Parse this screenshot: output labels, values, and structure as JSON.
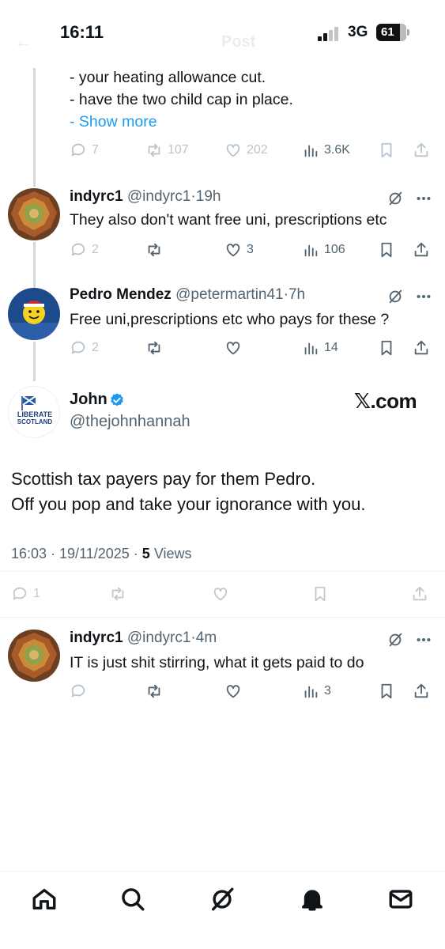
{
  "status_bar": {
    "time": "16:11",
    "network": "3G",
    "battery": "61"
  },
  "header": {
    "back_label": "←",
    "title": "Post"
  },
  "quoted_post": {
    "lines": [
      "- your heating allowance cut.",
      "- have the two child cap in place."
    ],
    "show_more_prefix": "- ",
    "show_more": "Show more",
    "actions": {
      "replies": "7",
      "reposts": "107",
      "likes": "202",
      "views": "3.6K"
    }
  },
  "posts": [
    {
      "name": "indyrc1",
      "handle": "@indyrc1",
      "time": "19h",
      "text": "They also don't want free uni, prescriptions etc",
      "actions": {
        "replies": "2",
        "reposts": "",
        "likes": "3",
        "views": "106"
      }
    },
    {
      "name": "Pedro Mendez",
      "handle": "@petermartin41",
      "time": "7h",
      "text": "Free uni,prescriptions etc who pays for these ?",
      "actions": {
        "replies": "2",
        "reposts": "",
        "likes": "",
        "views": "14"
      }
    }
  ],
  "main_post": {
    "name": "John",
    "handle": "@thejohnhannah",
    "avatar_text": [
      "LIBERATE",
      "SCOTLAND"
    ],
    "watermark": "𝕏.com",
    "text_lines": [
      "Scottish tax payers pay for them Pedro.",
      "Off you pop and take your ignorance with you."
    ],
    "timestamp": "16:03 · 19/11/2025 · ",
    "views_count": "5",
    "views_label": " Views",
    "actions": {
      "replies": "1"
    }
  },
  "reply": {
    "name": "indyrc1",
    "handle": "@indyrc1",
    "time": "4m",
    "text": "IT is just shit stirring, what it gets paid to do",
    "actions": {
      "views": "3"
    }
  },
  "separator": "·",
  "colors": {
    "accent": "#1d9bf0",
    "text": "#0f1419",
    "secondary": "#536471",
    "thread_line": "#cfd9de"
  },
  "nav_icons": [
    "home-icon",
    "search-icon",
    "grok-icon",
    "notifications-icon",
    "messages-icon"
  ]
}
